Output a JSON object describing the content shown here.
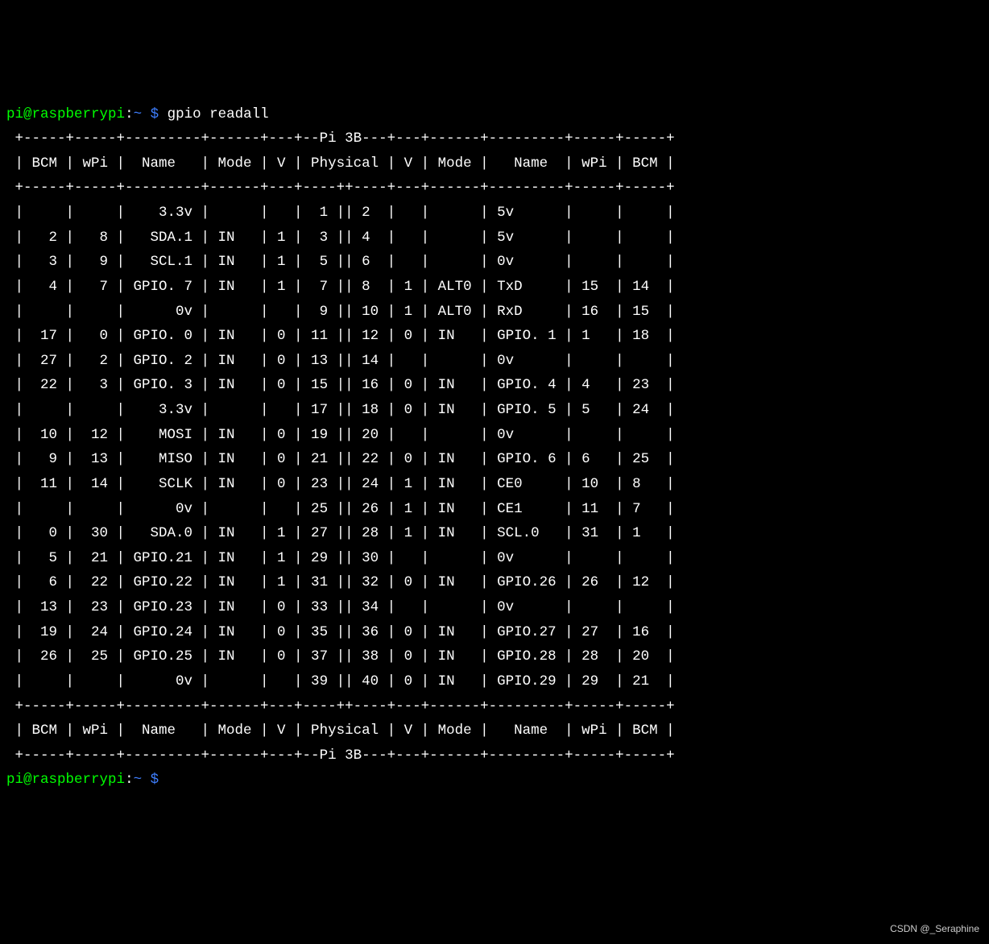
{
  "prompt": {
    "user": "pi",
    "at": "@",
    "host": "raspberrypi",
    "colon": ":",
    "path": "~",
    "dollar": " $ "
  },
  "command": "gpio readall",
  "model": "Pi 3B",
  "watermark": "CSDN @_Seraphine",
  "headers": [
    "BCM",
    "wPi",
    "Name",
    "Mode",
    "V",
    "Physical",
    "V",
    "Mode",
    "Name",
    "wPi",
    "BCM"
  ],
  "rows": [
    {
      "bcm_l": "",
      "wpi_l": "",
      "name_l": "3.3v",
      "mode_l": "",
      "v_l": "",
      "phys_l": "1",
      "phys_r": "2",
      "v_r": "",
      "mode_r": "",
      "name_r": "5v",
      "wpi_r": "",
      "bcm_r": ""
    },
    {
      "bcm_l": "2",
      "wpi_l": "8",
      "name_l": "SDA.1",
      "mode_l": "IN",
      "v_l": "1",
      "phys_l": "3",
      "phys_r": "4",
      "v_r": "",
      "mode_r": "",
      "name_r": "5v",
      "wpi_r": "",
      "bcm_r": ""
    },
    {
      "bcm_l": "3",
      "wpi_l": "9",
      "name_l": "SCL.1",
      "mode_l": "IN",
      "v_l": "1",
      "phys_l": "5",
      "phys_r": "6",
      "v_r": "",
      "mode_r": "",
      "name_r": "0v",
      "wpi_r": "",
      "bcm_r": ""
    },
    {
      "bcm_l": "4",
      "wpi_l": "7",
      "name_l": "GPIO. 7",
      "mode_l": "IN",
      "v_l": "1",
      "phys_l": "7",
      "phys_r": "8",
      "v_r": "1",
      "mode_r": "ALT0",
      "name_r": "TxD",
      "wpi_r": "15",
      "bcm_r": "14"
    },
    {
      "bcm_l": "",
      "wpi_l": "",
      "name_l": "0v",
      "mode_l": "",
      "v_l": "",
      "phys_l": "9",
      "phys_r": "10",
      "v_r": "1",
      "mode_r": "ALT0",
      "name_r": "RxD",
      "wpi_r": "16",
      "bcm_r": "15"
    },
    {
      "bcm_l": "17",
      "wpi_l": "0",
      "name_l": "GPIO. 0",
      "mode_l": "IN",
      "v_l": "0",
      "phys_l": "11",
      "phys_r": "12",
      "v_r": "0",
      "mode_r": "IN",
      "name_r": "GPIO. 1",
      "wpi_r": "1",
      "bcm_r": "18"
    },
    {
      "bcm_l": "27",
      "wpi_l": "2",
      "name_l": "GPIO. 2",
      "mode_l": "IN",
      "v_l": "0",
      "phys_l": "13",
      "phys_r": "14",
      "v_r": "",
      "mode_r": "",
      "name_r": "0v",
      "wpi_r": "",
      "bcm_r": ""
    },
    {
      "bcm_l": "22",
      "wpi_l": "3",
      "name_l": "GPIO. 3",
      "mode_l": "IN",
      "v_l": "0",
      "phys_l": "15",
      "phys_r": "16",
      "v_r": "0",
      "mode_r": "IN",
      "name_r": "GPIO. 4",
      "wpi_r": "4",
      "bcm_r": "23"
    },
    {
      "bcm_l": "",
      "wpi_l": "",
      "name_l": "3.3v",
      "mode_l": "",
      "v_l": "",
      "phys_l": "17",
      "phys_r": "18",
      "v_r": "0",
      "mode_r": "IN",
      "name_r": "GPIO. 5",
      "wpi_r": "5",
      "bcm_r": "24"
    },
    {
      "bcm_l": "10",
      "wpi_l": "12",
      "name_l": "MOSI",
      "mode_l": "IN",
      "v_l": "0",
      "phys_l": "19",
      "phys_r": "20",
      "v_r": "",
      "mode_r": "",
      "name_r": "0v",
      "wpi_r": "",
      "bcm_r": ""
    },
    {
      "bcm_l": "9",
      "wpi_l": "13",
      "name_l": "MISO",
      "mode_l": "IN",
      "v_l": "0",
      "phys_l": "21",
      "phys_r": "22",
      "v_r": "0",
      "mode_r": "IN",
      "name_r": "GPIO. 6",
      "wpi_r": "6",
      "bcm_r": "25"
    },
    {
      "bcm_l": "11",
      "wpi_l": "14",
      "name_l": "SCLK",
      "mode_l": "IN",
      "v_l": "0",
      "phys_l": "23",
      "phys_r": "24",
      "v_r": "1",
      "mode_r": "IN",
      "name_r": "CE0",
      "wpi_r": "10",
      "bcm_r": "8"
    },
    {
      "bcm_l": "",
      "wpi_l": "",
      "name_l": "0v",
      "mode_l": "",
      "v_l": "",
      "phys_l": "25",
      "phys_r": "26",
      "v_r": "1",
      "mode_r": "IN",
      "name_r": "CE1",
      "wpi_r": "11",
      "bcm_r": "7"
    },
    {
      "bcm_l": "0",
      "wpi_l": "30",
      "name_l": "SDA.0",
      "mode_l": "IN",
      "v_l": "1",
      "phys_l": "27",
      "phys_r": "28",
      "v_r": "1",
      "mode_r": "IN",
      "name_r": "SCL.0",
      "wpi_r": "31",
      "bcm_r": "1"
    },
    {
      "bcm_l": "5",
      "wpi_l": "21",
      "name_l": "GPIO.21",
      "mode_l": "IN",
      "v_l": "1",
      "phys_l": "29",
      "phys_r": "30",
      "v_r": "",
      "mode_r": "",
      "name_r": "0v",
      "wpi_r": "",
      "bcm_r": ""
    },
    {
      "bcm_l": "6",
      "wpi_l": "22",
      "name_l": "GPIO.22",
      "mode_l": "IN",
      "v_l": "1",
      "phys_l": "31",
      "phys_r": "32",
      "v_r": "0",
      "mode_r": "IN",
      "name_r": "GPIO.26",
      "wpi_r": "26",
      "bcm_r": "12"
    },
    {
      "bcm_l": "13",
      "wpi_l": "23",
      "name_l": "GPIO.23",
      "mode_l": "IN",
      "v_l": "0",
      "phys_l": "33",
      "phys_r": "34",
      "v_r": "",
      "mode_r": "",
      "name_r": "0v",
      "wpi_r": "",
      "bcm_r": ""
    },
    {
      "bcm_l": "19",
      "wpi_l": "24",
      "name_l": "GPIO.24",
      "mode_l": "IN",
      "v_l": "0",
      "phys_l": "35",
      "phys_r": "36",
      "v_r": "0",
      "mode_r": "IN",
      "name_r": "GPIO.27",
      "wpi_r": "27",
      "bcm_r": "16"
    },
    {
      "bcm_l": "26",
      "wpi_l": "25",
      "name_l": "GPIO.25",
      "mode_l": "IN",
      "v_l": "0",
      "phys_l": "37",
      "phys_r": "38",
      "v_r": "0",
      "mode_r": "IN",
      "name_r": "GPIO.28",
      "wpi_r": "28",
      "bcm_r": "20"
    },
    {
      "bcm_l": "",
      "wpi_l": "",
      "name_l": "0v",
      "mode_l": "",
      "v_l": "",
      "phys_l": "39",
      "phys_r": "40",
      "v_r": "0",
      "mode_r": "IN",
      "name_r": "GPIO.29",
      "wpi_r": "29",
      "bcm_r": "21"
    }
  ]
}
